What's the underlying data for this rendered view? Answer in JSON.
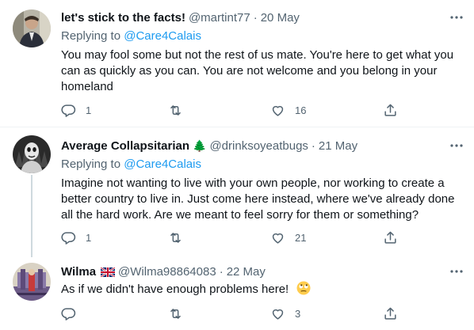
{
  "tweets": [
    {
      "name": "let's stick to the facts!",
      "handle": "@martint77",
      "separator": "·",
      "date": "20 May",
      "replying_prefix": "Replying to ",
      "replying_to": "@Care4Calais",
      "text": "You may fool some but not the rest of us mate. You're here to get what you can as quickly as you can. You are not welcome and you belong in your homeland",
      "replies": "1",
      "retweets": "",
      "likes": "16"
    },
    {
      "name": "Average Collapsitarian",
      "name_emoji": "🌲",
      "handle": "@drinksoyeatbugs",
      "separator": "·",
      "date": "21 May",
      "replying_prefix": "Replying to ",
      "replying_to": "@Care4Calais",
      "text": "Imagine not wanting to live with your own people, nor working to create a better country to live in. Just come here instead, where we've already done all the hard work. Are we meant to feel sorry for them or something?",
      "replies": "1",
      "retweets": "",
      "likes": "21"
    },
    {
      "name": "Wilma",
      "handle": "@Wilma98864083",
      "separator": "·",
      "date": "22 May",
      "text": "As if we didn't have enough problems here!",
      "replies": "",
      "retweets": "",
      "likes": "3"
    }
  ],
  "icons": {
    "reply": "reply-icon",
    "retweet": "retweet-icon",
    "like": "heart-icon",
    "share": "share-icon",
    "more": "more-icon"
  },
  "colors": {
    "text": "#0f1419",
    "muted": "#536471",
    "link": "#1d9bf0",
    "divider": "#eff3f4"
  }
}
